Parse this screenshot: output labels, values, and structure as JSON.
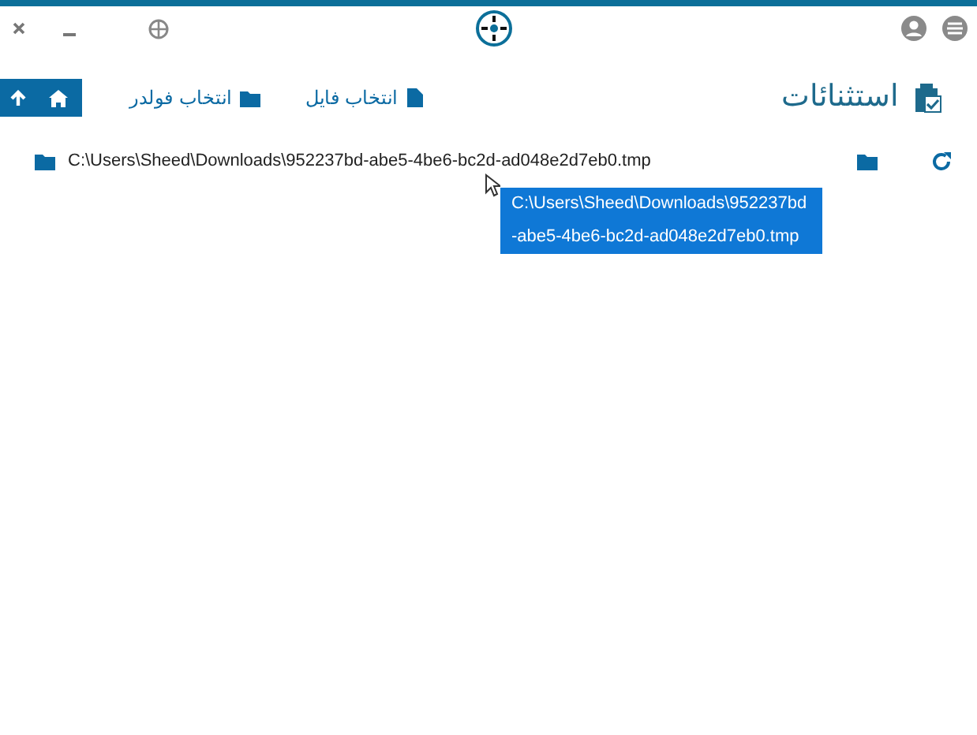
{
  "page": {
    "title": "استثنائات"
  },
  "toolbar": {
    "buttons": [
      {
        "label": "انتخاب فایل",
        "kind": "file"
      },
      {
        "label": "انتخاب فولدر",
        "kind": "folder"
      }
    ]
  },
  "exclusions": [
    {
      "path": "C:\\Users\\Sheed\\Downloads\\952237bd-abe5-4be6-bc2d-ad048e2d7eb0.tmp"
    }
  ],
  "tooltip": {
    "text": "C:\\Users\\Sheed\\Downloads\\952237bd-abe5-4be6-bc2d-ad048e2d7eb0.tmp"
  }
}
